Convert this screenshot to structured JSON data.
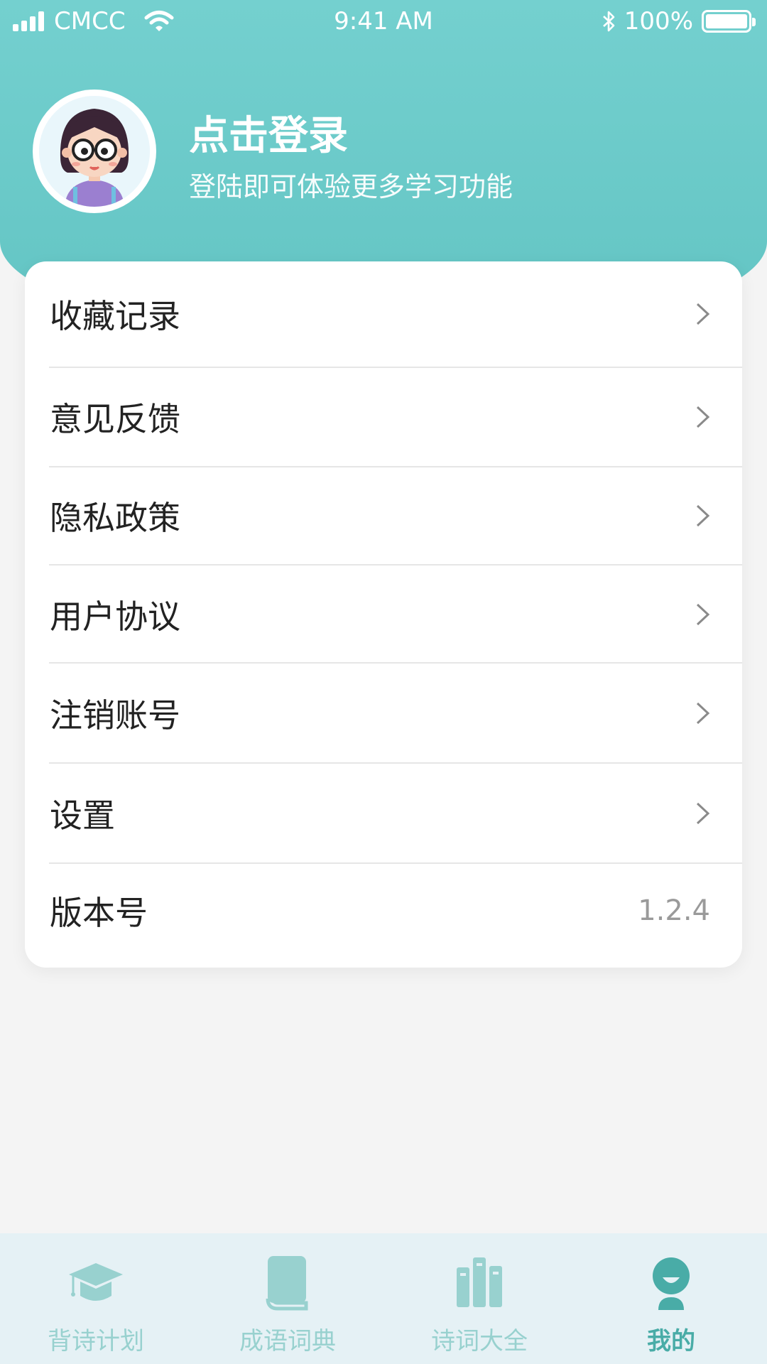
{
  "status_bar": {
    "carrier": "CMCC",
    "time": "9:41 AM",
    "battery": "100%"
  },
  "profile": {
    "title": "点击登录",
    "subtitle": "登陆即可体验更多学习功能"
  },
  "menu": {
    "items": [
      {
        "label": "收藏记录"
      },
      {
        "label": "意见反馈"
      },
      {
        "label": "隐私政策"
      },
      {
        "label": "用户协议"
      },
      {
        "label": "注销账号"
      },
      {
        "label": "设置"
      }
    ],
    "version": {
      "label": "版本号",
      "value": "1.2.4"
    }
  },
  "tabbar": {
    "tabs": [
      {
        "label": "背诗计划",
        "icon": "graduation-cap-icon",
        "active": false
      },
      {
        "label": "成语词典",
        "icon": "book-icon",
        "active": false
      },
      {
        "label": "诗词大全",
        "icon": "books-icon",
        "active": false
      },
      {
        "label": "我的",
        "icon": "user-icon",
        "active": true
      }
    ]
  },
  "colors": {
    "header": "#6cccca",
    "tab_active": "#49aca7",
    "tab_inactive": "#98d1cf",
    "tabbar_bg": "#e5f1f5"
  }
}
